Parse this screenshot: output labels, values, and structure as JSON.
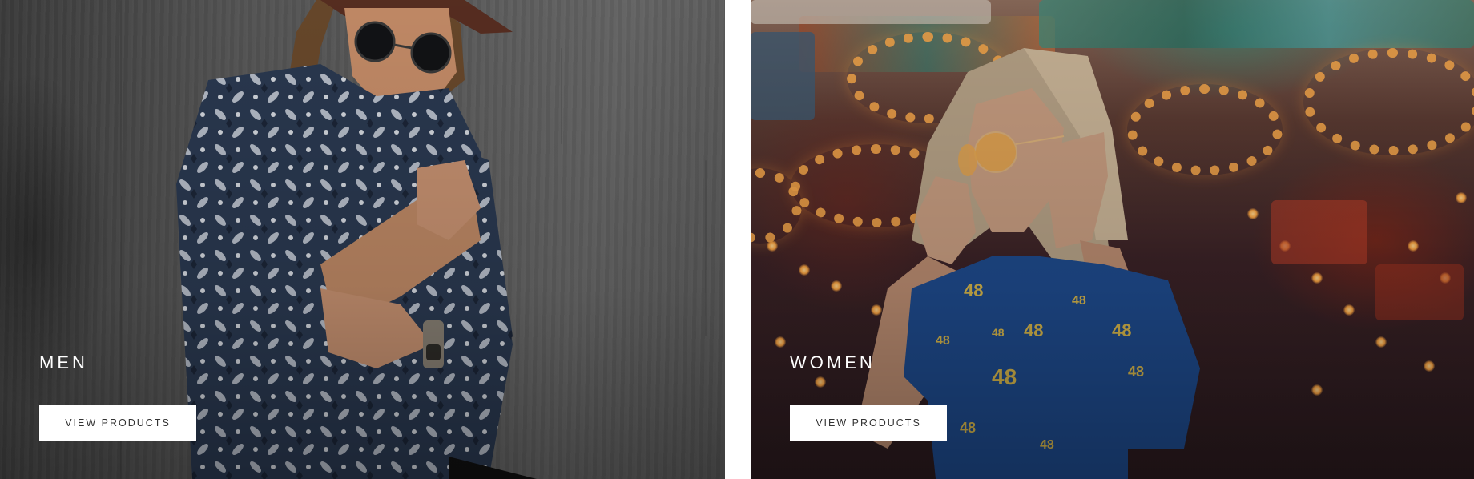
{
  "categories": [
    {
      "title": "MEN",
      "button_label": "VIEW PRODUCTS",
      "image_subject": "man in patterned blue shirt and sunglasses leaning on concrete wall"
    },
    {
      "title": "WOMEN",
      "button_label": "VIEW PRODUCTS",
      "image_subject": "woman with blonde hair and orange sunglasses in blue 48 shirt in front of carnival lights"
    }
  ],
  "colors": {
    "button_bg": "#ffffff",
    "button_text": "#333333",
    "title_text": "#ffffff",
    "gutter": "#ffffff"
  }
}
